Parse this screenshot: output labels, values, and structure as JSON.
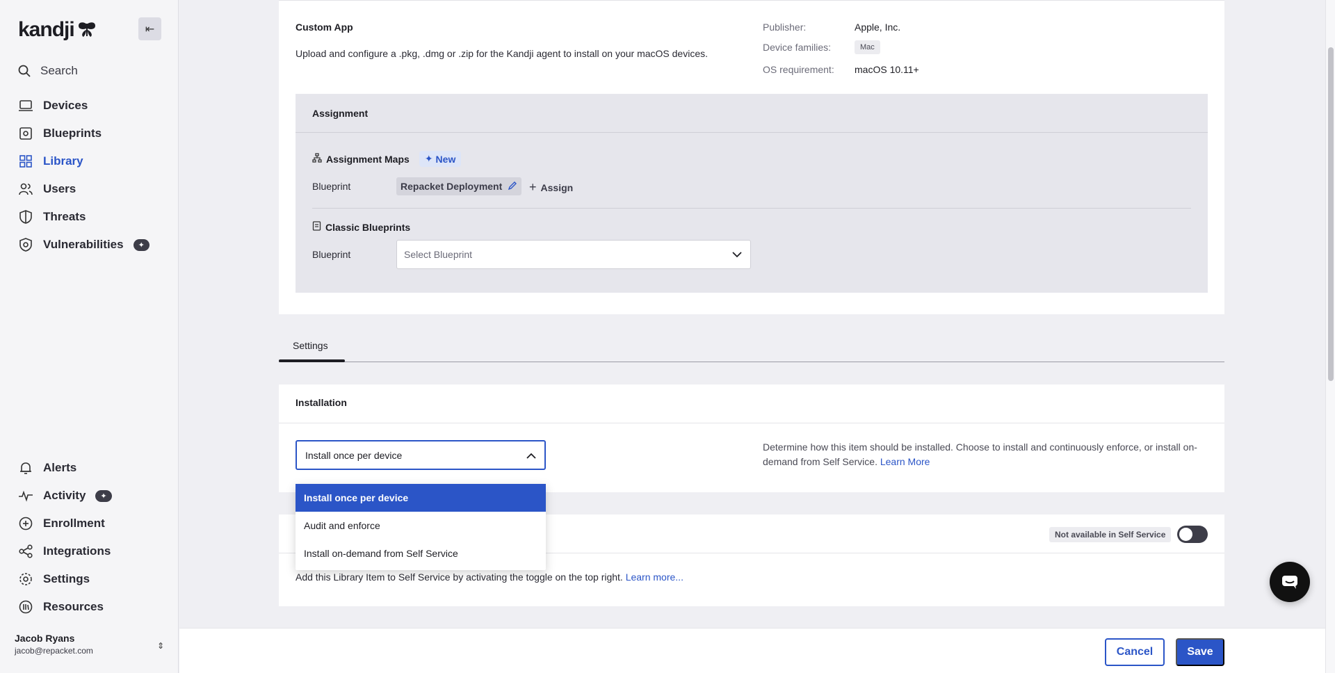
{
  "sidebar": {
    "brand": "kandji",
    "search_label": "Search",
    "nav_top": [
      {
        "label": "Devices",
        "icon": "laptop-icon"
      },
      {
        "label": "Blueprints",
        "icon": "blueprint-icon"
      },
      {
        "label": "Library",
        "icon": "grid-icon",
        "active": true
      },
      {
        "label": "Users",
        "icon": "users-icon"
      },
      {
        "label": "Threats",
        "icon": "shield-icon"
      },
      {
        "label": "Vulnerabilities",
        "icon": "shield-bug-icon"
      }
    ],
    "nav_bottom": [
      {
        "label": "Alerts",
        "icon": "bell-icon"
      },
      {
        "label": "Activity",
        "icon": "activity-icon"
      },
      {
        "label": "Enrollment",
        "icon": "plus-circle-icon"
      },
      {
        "label": "Integrations",
        "icon": "share-icon"
      },
      {
        "label": "Settings",
        "icon": "gear-icon"
      },
      {
        "label": "Resources",
        "icon": "resources-icon"
      }
    ],
    "user": {
      "name": "Jacob Ryans",
      "email": "jacob@repacket.com"
    }
  },
  "app_info": {
    "title": "Custom App",
    "description": "Upload and configure a .pkg, .dmg or .zip for the Kandji agent to install on your macOS devices.",
    "publisher_label": "Publisher:",
    "publisher_value": "Apple, Inc.",
    "device_families_label": "Device families:",
    "device_families_value": "Mac",
    "os_requirement_label": "OS requirement:",
    "os_requirement_value": "macOS 10.11+"
  },
  "assignment": {
    "header": "Assignment",
    "maps_title": "Assignment Maps",
    "new_badge": "New",
    "blueprint_label": "Blueprint",
    "assigned_blueprint": "Repacket Deployment",
    "assign_link": "Assign",
    "classic_title": "Classic Blueprints",
    "classic_blueprint_label": "Blueprint",
    "select_placeholder": "Select Blueprint"
  },
  "tabs": [
    {
      "label": "Settings",
      "active": true
    }
  ],
  "installation": {
    "title": "Installation",
    "selected": "Install once per device",
    "help_text": "Determine how this item should be installed. Choose to install and continuously enforce, or install on-demand from Self Service.",
    "help_link": "Learn More",
    "options": [
      "Install once per device",
      "Audit and enforce",
      "Install on-demand from Self Service"
    ]
  },
  "self_service": {
    "badge": "Not available in Self Service",
    "toggle_on": false,
    "text": "Add this Library Item to Self Service by activating the toggle on the top right.",
    "link": "Learn more..."
  },
  "footer": {
    "cancel": "Cancel",
    "save": "Save"
  },
  "colors": {
    "accent": "#2b55c7",
    "sidebar_bg": "#f5f5f7",
    "page_bg": "#efeff3"
  }
}
